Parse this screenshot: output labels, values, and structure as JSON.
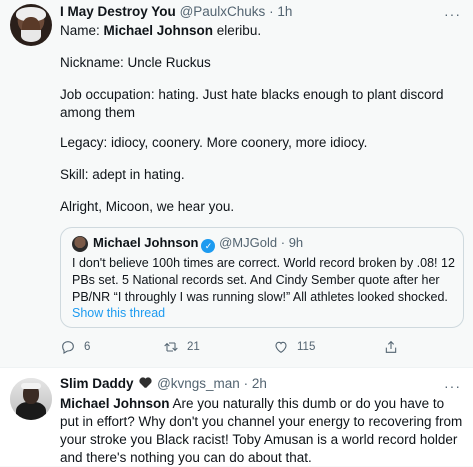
{
  "tweet1": {
    "display_name": "I May Destroy You",
    "handle": "@PaulxChuks",
    "separator": "·",
    "time": "1h",
    "more": "···",
    "lines": {
      "name_prefix": "Name: ",
      "name_bold": "Michael Johnson",
      "name_suffix": " eleribu.",
      "nickname": "Nickname: Uncle Ruckus",
      "job": "Job occupation: hating. Just hate blacks enough to plant discord among them",
      "legacy": "Legacy: idiocy, coonery. More coonery, more idiocy.",
      "skill": "Skill: adept in hating.",
      "closing": "Alright, Micoon, we hear you."
    },
    "quote": {
      "display_name": "Michael Johnson",
      "verified": "✓",
      "handle": "@MJGold",
      "separator": "·",
      "time": "9h",
      "text": "I don't believe 100h times are correct. World record broken by .08! 12 PBs set. 5 National records set. And Cindy Sember quote after her PB/NR “I throughly I was running slow!” All athletes looked shocked.",
      "show_thread": "Show this thread"
    },
    "actions": {
      "replies": "6",
      "retweets": "21",
      "likes": "115"
    }
  },
  "tweet2": {
    "display_name": "Slim Daddy",
    "emoji": "black-heart",
    "handle": "@kvngs_man",
    "separator": "·",
    "time": "2h",
    "more": "···",
    "mention_bold": "Michael Johnson",
    "text": " Are you naturally this dumb or do you have to put in effort? Why don't you channel your energy to recovering from your stroke you Black racist! Toby Amusan is a world record holder and there's nothing you can do about that."
  }
}
